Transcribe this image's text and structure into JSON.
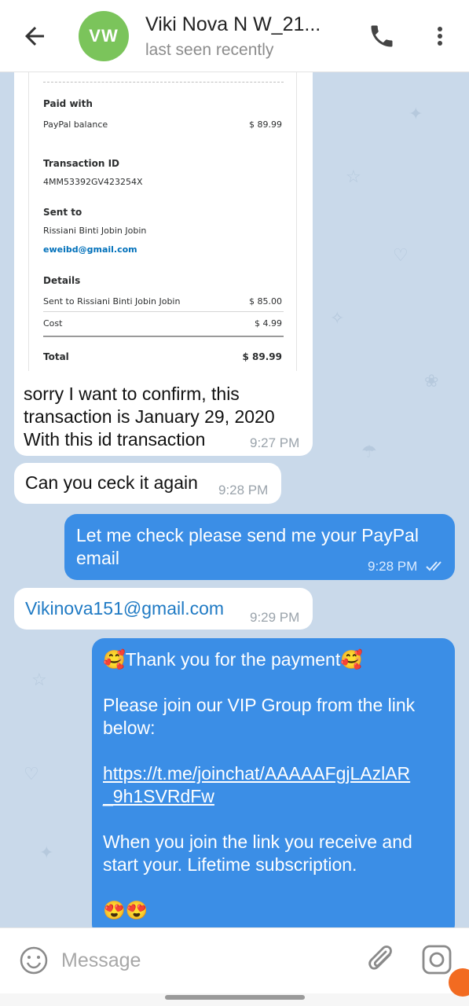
{
  "header": {
    "title": "Viki Nova N W_21...",
    "subtitle": "last seen recently",
    "avatar_initials": "VW",
    "avatar_color": "#7bc45b"
  },
  "receipt": {
    "paid_with_heading": "Paid with",
    "paid_with_method": "PayPal balance",
    "paid_with_amount": "$ 89.99",
    "transaction_heading": "Transaction ID",
    "transaction_id": "4MM53392GV423254X",
    "sent_to_heading": "Sent to",
    "sent_to_name": "Rissiani Binti Jobin Jobin",
    "sent_to_email": "eweibd@gmail.com",
    "details_heading": "Details",
    "detail_line_label": "Sent to Rissiani Binti Jobin Jobin",
    "detail_line_amount": "$ 85.00",
    "cost_label": "Cost",
    "cost_amount": "$ 4.99",
    "total_label": "Total",
    "total_amount": "$ 89.99"
  },
  "messages": [
    {
      "direction": "in",
      "lines": [
        "sorry I want to confirm, this",
        "transaction is January 29, 2020",
        "With this id transaction"
      ],
      "time": "9:27 PM"
    },
    {
      "direction": "in",
      "text": "Can you ceck it again",
      "time": "9:28 PM"
    },
    {
      "direction": "out",
      "lines": [
        "Let me check please send me your PayPal",
        "email"
      ],
      "time": "9:28 PM",
      "status": "read"
    },
    {
      "direction": "in",
      "link_text": "Vikinova151@gmail.com",
      "time": "9:29 PM"
    },
    {
      "direction": "out",
      "line1": "🥰Thank you for the payment🥰",
      "line2a": "Please join our VIP Group from the link",
      "line2b": "below:",
      "link_a": "https://t.me/joinchat/AAAAAFgjLAzlAR",
      "link_b": "_9h1SVRdFw",
      "line3a": "When you join the link you receive and",
      "line3b": "start your. Lifetime subscription.",
      "emojis": "😍😍"
    }
  ],
  "composer": {
    "placeholder": "Message"
  },
  "colors": {
    "chat_background": "#c9d9ea",
    "outgoing_bubble": "#3b8ee6",
    "incoming_bubble": "#ffffff"
  },
  "icons": {
    "back": "arrow-left-icon",
    "call": "phone-icon",
    "more": "more-vertical-icon",
    "emoji": "smiley-icon",
    "attach": "paperclip-icon",
    "camera": "camera-icon",
    "read_status": "double-check-icon"
  }
}
